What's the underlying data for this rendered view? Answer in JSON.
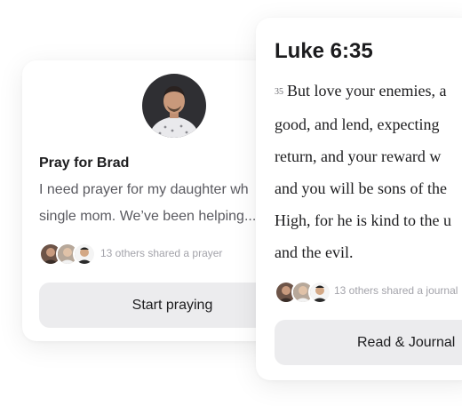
{
  "prayer_card": {
    "title": "Pray for Brad",
    "body_lines": [
      "I need prayer for my daughter wh",
      "single mom. We’ve been helping..."
    ],
    "shared_text": "13 others shared a prayer",
    "button_label": "Start praying"
  },
  "verse_card": {
    "title": "Luke 6:35",
    "verse_number": "35",
    "lines": [
      "But love your enemies, a",
      "good, and lend, expecting",
      "return, and your reward w",
      "and you will be sons of the",
      "High, for he is kind to the u",
      "and the evil."
    ],
    "shared_text": "13 others shared a journal",
    "button_label": "Read & Journal"
  },
  "colors": {
    "card_bg": "#ffffff",
    "button_bg": "#ececee",
    "text_primary": "#1c1c1e",
    "text_muted": "#a3a3aa"
  }
}
